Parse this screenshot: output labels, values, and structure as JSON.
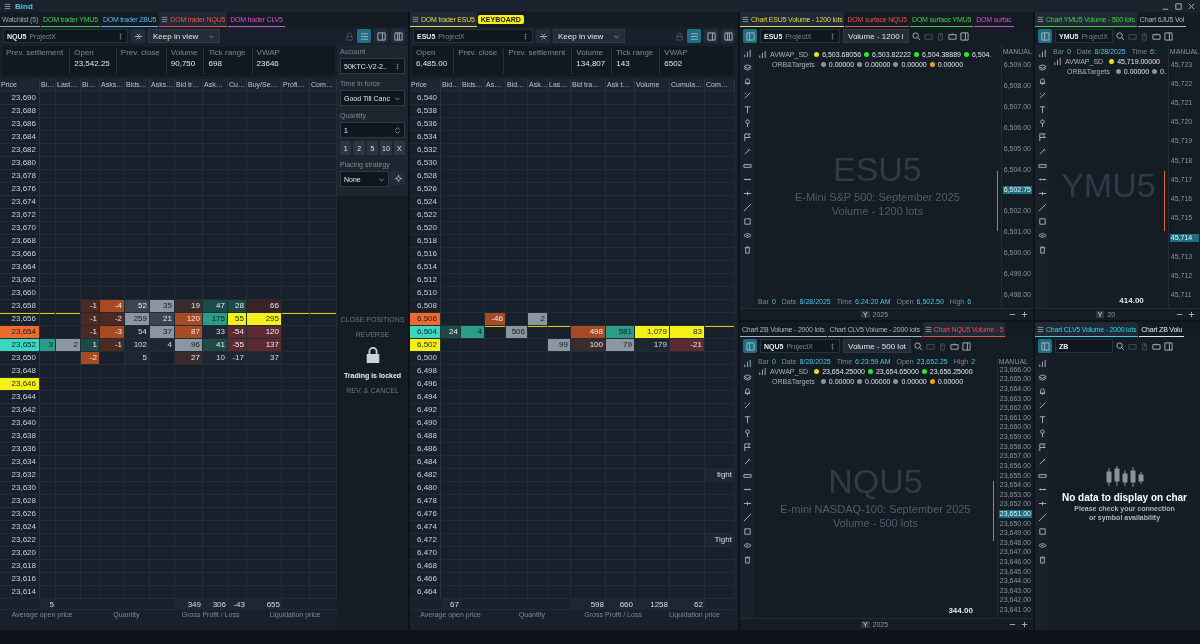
{
  "title_bar": {
    "title": "Bind"
  },
  "doms": [
    {
      "tabs": [
        {
          "label": "Watchlist (5)",
          "color": "#9aa4ae",
          "selected": false
        },
        {
          "label": "DOM trader YMU5",
          "color": "#3fd13f",
          "selected": false
        },
        {
          "label": "DOM trader ZBU5",
          "color": "#5ab4e8",
          "selected": false
        },
        {
          "label": "DOM trader NQU5",
          "color": "#e8504d",
          "selected": true
        },
        {
          "label": "DOM trader CLV5",
          "color": "#d34fd6",
          "selected": false
        }
      ],
      "symbol": "NQU5",
      "exchange": "ProjectX",
      "follow_mode": "Keep in view",
      "stats": [
        {
          "label": "Prev. settlement"
        },
        {
          "label": "Open",
          "value": "23,542.25"
        },
        {
          "label": "Prev. close"
        },
        {
          "label": "Volume",
          "value": "90,750"
        },
        {
          "label": "Tick range",
          "value": "698"
        },
        {
          "label": "VWAP",
          "value": "23646"
        }
      ],
      "columns": [
        "Price",
        "Bi…",
        "Last…",
        "Bi…",
        "Asks…",
        "Bids…",
        "Asks…",
        "Bid tr…",
        "Ask…",
        "Cu…",
        "Buy/Se…",
        "Profi…",
        "Com…"
      ],
      "rows": [
        {
          "price": "23,690"
        },
        {
          "price": "23,688"
        },
        {
          "price": "23,686"
        },
        {
          "price": "23,684"
        },
        {
          "price": "23,682"
        },
        {
          "price": "23,680"
        },
        {
          "price": "23,678"
        },
        {
          "price": "23,676"
        },
        {
          "price": "23,674"
        },
        {
          "price": "23,672"
        },
        {
          "price": "23,670"
        },
        {
          "price": "23,668"
        },
        {
          "price": "23,666"
        },
        {
          "price": "23,664"
        },
        {
          "price": "23,662"
        },
        {
          "price": "23,660"
        },
        {
          "price": "23,658",
          "cells": [
            {
              "kind": "blank"
            },
            {
              "kind": "blank"
            },
            {
              "text": "-1",
              "color": "#4b2a24"
            },
            {
              "text": "-4",
              "color": "#a84a24"
            },
            {
              "text": "52",
              "color": "#3b4552"
            },
            {
              "text": "35",
              "color": "#8c96a1"
            },
            {
              "text": "19",
              "color": "#3b2b2c"
            },
            {
              "text": "47",
              "color": "#1d4a46"
            },
            {
              "text": "28",
              "color": "#1d4a46"
            },
            {
              "text": "66",
              "color": "#3a2228"
            }
          ]
        },
        {
          "price": "23,656",
          "current": true,
          "cells": [
            {
              "kind": "blank"
            },
            {
              "kind": "blank"
            },
            {
              "text": "-1",
              "color": "#4b2a24"
            },
            {
              "text": "-2",
              "color": "#4b2a24"
            },
            {
              "text": "259",
              "color": "#8c96a1"
            },
            {
              "text": "21",
              "color": "#3b4552"
            },
            {
              "text": "120",
              "color": "#a84a24"
            },
            {
              "text": "175",
              "color": "#2a9c88"
            },
            {
              "text": "55",
              "color": "#f6f01a"
            },
            {
              "text": "295",
              "color": "#f6f01a"
            }
          ]
        },
        {
          "price": "23,654",
          "color": "#ee6a2e",
          "cells": [
            {
              "kind": "blank"
            },
            {
              "kind": "blank"
            },
            {
              "text": "-1",
              "color": "#4b2a24"
            },
            {
              "text": "-3",
              "color": "#a84a24"
            },
            {
              "text": "54"
            },
            {
              "text": "37",
              "color": "#8c96a1"
            },
            {
              "text": "87",
              "color": "#a84a24"
            },
            {
              "text": "33"
            },
            {
              "text": "-54",
              "color": "#5e2a32"
            },
            {
              "text": "120",
              "color": "#5e2a32"
            }
          ]
        },
        {
          "price": "23,652",
          "color": "#3ad8c2",
          "cells": [
            {
              "text": "3",
              "color": "#2a9c88"
            },
            {
              "text": "2",
              "color": "#8c96a1"
            },
            {
              "text": "1",
              "color": "#1d4a46"
            },
            {
              "text": "-1",
              "color": "#4b2a24"
            },
            {
              "text": "102"
            },
            {
              "text": "4"
            },
            {
              "text": "96",
              "color": "#8c96a1"
            },
            {
              "text": "41",
              "color": "#1d4a46"
            },
            {
              "text": "-55",
              "color": "#5e2a32"
            },
            {
              "text": "137",
              "color": "#5e2a32"
            }
          ]
        },
        {
          "price": "23,650",
          "cells": [
            {
              "kind": "blank"
            },
            {
              "kind": "blank"
            },
            {
              "text": "-2",
              "color": "#a84a24"
            },
            {
              "kind": "blank"
            },
            {
              "text": "5"
            },
            {
              "kind": "blank"
            },
            {
              "text": "27",
              "color": "#3b2b2c"
            },
            {
              "text": "10"
            },
            {
              "text": "-17"
            },
            {
              "text": "37"
            }
          ]
        },
        {
          "price": "23,648"
        },
        {
          "price": "23,646",
          "color": "#f6f01a"
        },
        {
          "price": "23,644"
        },
        {
          "price": "23,642"
        },
        {
          "price": "23,640"
        },
        {
          "price": "23,638"
        },
        {
          "price": "23,636"
        },
        {
          "price": "23,634"
        },
        {
          "price": "23,632"
        },
        {
          "price": "23,630"
        },
        {
          "price": "23,628"
        },
        {
          "price": "23,626"
        },
        {
          "price": "23,624"
        },
        {
          "price": "23,622"
        },
        {
          "price": "23,620"
        },
        {
          "price": "23,618"
        },
        {
          "price": "23,616"
        },
        {
          "price": "23,614"
        }
      ],
      "totals": [
        {
          "text": "5"
        },
        {
          "kind": "blank"
        },
        {
          "kind": "blank"
        },
        {
          "kind": "blank"
        },
        {
          "kind": "blank"
        },
        {
          "kind": "blank"
        },
        {
          "text": "349"
        },
        {
          "text": "306"
        },
        {
          "text": "-43"
        },
        {
          "text": "655"
        }
      ],
      "footer": [
        "Average open price",
        "Quantity",
        "Gross Profit / Loss",
        "Liquidation price"
      ],
      "side_panel": {
        "account_label": "Account",
        "account": "50KTC-V2-2..",
        "tif_label": "Time in force",
        "tif": "Good Till Canc",
        "quantity_label": "Quantity",
        "quantity": "1",
        "quick_quantities": [
          "1",
          "2",
          "5",
          "10",
          "X"
        ],
        "strategy_label": "Placing strategy",
        "strategy": "None",
        "locked_buttons": [
          "CLOSE POSITIONS",
          "REVERSE",
          "REV. & CANCEL"
        ],
        "lock_message": "Trading is locked"
      }
    },
    {
      "tabs": [
        {
          "label": "DOM trader ESU5",
          "color": "#e8d44d",
          "selected": true
        }
      ],
      "badge": "KEYBOARD",
      "symbol": "ESU5",
      "exchange": "ProjectX",
      "follow_mode": "Keep in view",
      "stats": [
        {
          "label": "Open",
          "value": "6,485.00"
        },
        {
          "label": "Prev. close"
        },
        {
          "label": "Prev. settlement"
        },
        {
          "label": "Volume",
          "value": "134,807"
        },
        {
          "label": "Tick range",
          "value": "143"
        },
        {
          "label": "VWAP",
          "value": "6502"
        }
      ],
      "columns": [
        "Price",
        "Bid…",
        "Bids…",
        "As…",
        "Bid…",
        "Ask…",
        "Las…",
        "Bid tra…",
        "Ask t…",
        "Volume",
        "Cumula…",
        "Com…"
      ],
      "rows": [
        {
          "price": "6,540"
        },
        {
          "price": "6,538"
        },
        {
          "price": "6,536"
        },
        {
          "price": "6,534"
        },
        {
          "price": "6,532"
        },
        {
          "price": "6,530"
        },
        {
          "price": "6,528"
        },
        {
          "price": "6,526"
        },
        {
          "price": "6,524"
        },
        {
          "price": "6,522"
        },
        {
          "price": "6,520"
        },
        {
          "price": "6,518"
        },
        {
          "price": "6,516"
        },
        {
          "price": "6,514"
        },
        {
          "price": "6,512"
        },
        {
          "price": "6,510"
        },
        {
          "price": "6,508"
        },
        {
          "price": "6,506",
          "color": "#ee6a2e",
          "cells": [
            {
              "kind": "blank"
            },
            {
              "kind": "blank"
            },
            {
              "text": "-46",
              "color": "#a84a24"
            },
            {
              "kind": "blank"
            },
            {
              "text": "2",
              "color": "#8c96a1"
            }
          ]
        },
        {
          "price": "6,504",
          "color": "#3ad8c2",
          "current": true,
          "cells": [
            {
              "text": "24",
              "color": "#1d4a46"
            },
            {
              "text": "4",
              "color": "#2a9c88"
            },
            {
              "kind": "blank"
            },
            {
              "text": "506",
              "color": "#8c96a1"
            },
            {
              "kind": "blank"
            },
            {
              "kind": "blank"
            },
            {
              "text": "498",
              "color": "#a84a24"
            },
            {
              "text": "581",
              "color": "#2a9c88"
            },
            {
              "text": "1,079",
              "color": "#f6f01a"
            },
            {
              "text": "83",
              "color": "#f6f01a"
            }
          ]
        },
        {
          "price": "6,502",
          "color": "#f6f01a",
          "cells": [
            {
              "kind": "blank"
            },
            {
              "kind": "blank"
            },
            {
              "kind": "blank"
            },
            {
              "kind": "blank"
            },
            {
              "kind": "blank"
            },
            {
              "text": "99",
              "color": "#8c96a1"
            },
            {
              "text": "100",
              "color": "#3b2b2c"
            },
            {
              "text": "79",
              "color": "#8c96a1"
            },
            {
              "text": "179"
            },
            {
              "text": "-21",
              "color": "#5e2a32"
            }
          ]
        },
        {
          "price": "6,500"
        },
        {
          "price": "6,498"
        },
        {
          "price": "6,496"
        },
        {
          "price": "6,494"
        },
        {
          "price": "6,492"
        },
        {
          "price": "6,490"
        },
        {
          "price": "6,488"
        },
        {
          "price": "6,486"
        },
        {
          "price": "6,484"
        },
        {
          "price": "6,482",
          "cells": [
            {
              "kind": "blank"
            },
            {
              "kind": "blank"
            },
            {
              "kind": "blank"
            },
            {
              "kind": "blank"
            },
            {
              "kind": "blank"
            },
            {
              "kind": "blank"
            },
            {
              "kind": "blank"
            },
            {
              "kind": "blank"
            },
            {
              "kind": "blank"
            },
            {
              "kind": "blank"
            },
            {
              "text": "tight"
            }
          ]
        },
        {
          "price": "6,480"
        },
        {
          "price": "6,478"
        },
        {
          "price": "6,476"
        },
        {
          "price": "6,474"
        },
        {
          "price": "6,472",
          "cells": [
            {
              "kind": "blank"
            },
            {
              "kind": "blank"
            },
            {
              "kind": "blank"
            },
            {
              "kind": "blank"
            },
            {
              "kind": "blank"
            },
            {
              "kind": "blank"
            },
            {
              "kind": "blank"
            },
            {
              "kind": "blank"
            },
            {
              "kind": "blank"
            },
            {
              "kind": "blank"
            },
            {
              "text": "Tight"
            }
          ]
        },
        {
          "price": "6,470"
        },
        {
          "price": "6,468"
        },
        {
          "price": "6,466"
        },
        {
          "price": "6,464"
        }
      ],
      "totals": [
        {
          "text": "67"
        },
        {
          "kind": "blank"
        },
        {
          "kind": "blank"
        },
        {
          "kind": "blank"
        },
        {
          "kind": "blank"
        },
        {
          "kind": "blank"
        },
        {
          "text": "598"
        },
        {
          "text": "660"
        },
        {
          "text": "1258"
        },
        {
          "text": "62"
        }
      ],
      "footer": [
        "Average open price",
        "Quantity",
        "Gross Profit / Loss",
        "Liquidation price"
      ]
    }
  ],
  "chart_columns": [
    {
      "panels": [
        {
          "tabs": [
            {
              "label": "Chart ESU5 Volume - 1200 lots",
              "color": "#e8d44d",
              "selected": true
            },
            {
              "label": "DOM surface NQU5",
              "color": "#e8504d",
              "selected": false
            },
            {
              "label": "DOM surface YMU5",
              "color": "#3fd13f",
              "selected": false
            },
            {
              "label": "DOM surfac",
              "color": "#d34fd6",
              "selected": false
            }
          ],
          "symbol": "ESU5",
          "exchange": "ProjectX",
          "series": "Volume - 1200 l",
          "status_info": [
            {
              "label": "Bar",
              "value": "0"
            },
            {
              "label": "Date",
              "value": "8/28/2025"
            },
            {
              "label": "Time",
              "value": "6:24:20 AM"
            },
            {
              "label": "Open",
              "value": "6,502.50"
            },
            {
              "label": "High",
              "value": "6"
            }
          ],
          "indicators": [
            {
              "name": "AVWAP_SD",
              "values": [
                {
                  "text": "6,503.68056",
                  "color": "#e8e020"
                },
                {
                  "text": "6,503.82222",
                  "color": "#2ee82e"
                },
                {
                  "text": "6,504.38889",
                  "color": "#2ee82e"
                },
                {
                  "text": "6,504.",
                  "color": "#2ee82e"
                }
              ]
            },
            {
              "name": "ORB&Targets",
              "values": [
                {
                  "text": "0.00000",
                  "color": "#8a949e"
                },
                {
                  "text": "0.00000",
                  "color": "#8a949e"
                },
                {
                  "text": "0.00000",
                  "color": "#8a949e"
                },
                {
                  "text": "0.00000",
                  "color": "#f0a020"
                }
              ]
            }
          ],
          "watermark": {
            "symbol": "ESU5",
            "description": "E-Mini S&P 500: September 2025",
            "series": "Volume - 1200 lots"
          },
          "axis_title": "MANUAL",
          "ticks": [
            {
              "text": "6,509.00",
              "kind": "tick"
            },
            {
              "text": "6,508.00",
              "kind": "tick"
            },
            {
              "text": "6,507.00",
              "kind": "tick"
            },
            {
              "text": "6,506.00",
              "kind": "tick"
            },
            {
              "text": "6,505.00",
              "kind": "tick"
            },
            {
              "text": "6,504.00",
              "kind": "tick"
            },
            {
              "text": "6,502.75",
              "kind": "current"
            },
            {
              "text": "6,502.00",
              "kind": "tick"
            },
            {
              "text": "6,501.00",
              "kind": "tick"
            },
            {
              "text": "6,500.00",
              "kind": "tick"
            },
            {
              "text": "6,499.00",
              "kind": "tick"
            },
            {
              "text": "6,498.00",
              "kind": "tick"
            }
          ],
          "year_badge": "Y",
          "year": "2025"
        },
        {
          "tabs": [
            {
              "label": "Chart ZB Volume - 2000 lots",
              "color": "#aab4be",
              "selected": false
            },
            {
              "label": "Chart CLV5 Volume - 2000 lots",
              "color": "#aab4be",
              "selected": false
            },
            {
              "label": "Chart NQU5 Volume - 5",
              "color": "#e8504d",
              "selected": true
            }
          ],
          "symbol": "NQU5",
          "exchange": "ProjectX",
          "series": "Volume - 500 lot",
          "info": [
            {
              "label": "Bar",
              "value": "0"
            },
            {
              "label": "Date",
              "value": "8/28/2025"
            },
            {
              "label": "Time",
              "value": "6:23:59 AM"
            },
            {
              "label": "Open",
              "value": "23,652.25"
            },
            {
              "label": "High",
              "value": "2"
            }
          ],
          "indicators": [
            {
              "name": "AVWAP_SD",
              "values": [
                {
                  "text": "23,654.25000",
                  "color": "#e8e020"
                },
                {
                  "text": "23,654.65000",
                  "color": "#2ee82e"
                },
                {
                  "text": "23,656.25000",
                  "color": "#2ee82e"
                }
              ]
            },
            {
              "name": "ORB&Targets",
              "values": [
                {
                  "text": "0.00000",
                  "color": "#8a949e"
                },
                {
                  "text": "0.00000",
                  "color": "#8a949e"
                },
                {
                  "text": "0.00000",
                  "color": "#8a949e"
                },
                {
                  "text": "0.00000",
                  "color": "#f0a020"
                }
              ]
            }
          ],
          "watermark": {
            "symbol": "NQU5",
            "description": "E-mini NASDAQ-100: September 2025",
            "series": "Volume - 500 lots"
          },
          "volume_label": "344.00",
          "axis_title": "MANUAL",
          "ticks": [
            {
              "text": "23,666.00",
              "kind": "tick"
            },
            {
              "text": "23,665.00",
              "kind": "tick"
            },
            {
              "text": "23,664.00",
              "kind": "tick"
            },
            {
              "text": "23,663.00",
              "kind": "tick"
            },
            {
              "text": "23,662.00",
              "kind": "tick"
            },
            {
              "text": "23,661.00",
              "kind": "tick"
            },
            {
              "text": "23,660.00",
              "kind": "tick"
            },
            {
              "text": "23,659.00",
              "kind": "tick"
            },
            {
              "text": "23,658.00",
              "kind": "tick"
            },
            {
              "text": "23,657.00",
              "kind": "tick"
            },
            {
              "text": "23,656.00",
              "kind": "tick"
            },
            {
              "text": "23,655.00",
              "kind": "tick"
            },
            {
              "text": "23,654.00",
              "kind": "tick"
            },
            {
              "text": "23,653.00",
              "kind": "tick"
            },
            {
              "text": "23,652.00",
              "kind": "tick"
            },
            {
              "text": "23,651.00",
              "kind": "current"
            },
            {
              "text": "23,650.00",
              "kind": "tick"
            },
            {
              "text": "23,649.00",
              "kind": "tick"
            },
            {
              "text": "23,648.00",
              "kind": "tick"
            },
            {
              "text": "23,647.00",
              "kind": "tick"
            },
            {
              "text": "23,646.00",
              "kind": "tick"
            },
            {
              "text": "23,645.00",
              "kind": "tick"
            },
            {
              "text": "23,644.00",
              "kind": "tick"
            },
            {
              "text": "23,643.00",
              "kind": "tick"
            },
            {
              "text": "23,642.00",
              "kind": "tick"
            },
            {
              "text": "23,641.00",
              "kind": "tick"
            }
          ],
          "year_badge": "Y",
          "year": "2025"
        }
      ]
    },
    {
      "panels": [
        {
          "tabs": [
            {
              "label": "Chart YMU5 Volume - 500 lots",
              "color": "#3fd13f",
              "selected": true
            },
            {
              "label": "Chart 6JU5 Vol",
              "color": "#aab4be",
              "selected": false
            }
          ],
          "symbol": "YMU5",
          "exchange": "ProjectX",
          "info": [
            {
              "label": "Bar",
              "value": "0"
            },
            {
              "label": "Date",
              "value": "8/28/2025"
            },
            {
              "label": "Time",
              "value": "6:"
            }
          ],
          "indicators": [
            {
              "name": "AVWAP_SD",
              "values": [
                {
                  "text": "45,719.00000",
                  "color": "#e8e020"
                }
              ]
            },
            {
              "name": "ORB&Targets",
              "values": [
                {
                  "text": "0.00000",
                  "color": "#8a949e"
                },
                {
                  "text": "0.",
                  "color": "#8a949e"
                }
              ]
            }
          ],
          "watermark": {
            "symbol": "YMU5"
          },
          "volume_label": "414.00",
          "axis_title": "MANUAL",
          "ticks": [
            {
              "text": "45,723",
              "kind": "tick"
            },
            {
              "text": "45,722",
              "kind": "tick"
            },
            {
              "text": "45,721",
              "kind": "tick"
            },
            {
              "text": "45,720",
              "kind": "tick"
            },
            {
              "text": "45,719",
              "kind": "tick"
            },
            {
              "text": "45,718",
              "kind": "tick"
            },
            {
              "text": "45,717",
              "kind": "tick"
            },
            {
              "text": "45,716",
              "kind": "tick"
            },
            {
              "text": "45,715",
              "kind": "tick"
            },
            {
              "text": "45,714",
              "kind": "current"
            },
            {
              "text": "45,713",
              "kind": "tick"
            },
            {
              "text": "45,712",
              "kind": "tick"
            },
            {
              "text": "45,711",
              "kind": "tick"
            }
          ],
          "year_badge": "Y",
          "year": "20"
        },
        {
          "tabs": [
            {
              "label": "Chart CLV5 Volume - 2000 lots",
              "color": "#2fd4e8",
              "selected": true
            },
            {
              "label": "Chart ZB Volu",
              "color": "#dfe5ea",
              "selected": false
            }
          ],
          "symbol": "ZB",
          "empty": {
            "title": "No data to display on char",
            "lines": [
              "Please check your connection",
              "or symbol availability"
            ]
          }
        }
      ]
    }
  ]
}
